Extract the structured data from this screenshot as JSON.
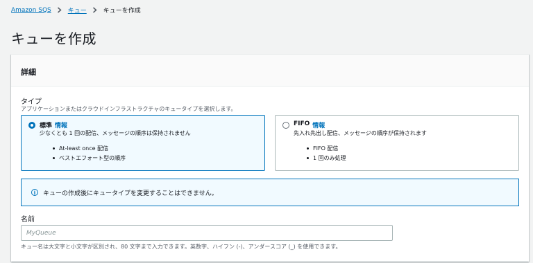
{
  "breadcrumb": {
    "items": [
      "Amazon SQS",
      "キュー"
    ],
    "current": "キューを作成"
  },
  "page": {
    "title": "キューを作成"
  },
  "details": {
    "header": "詳細",
    "type_label": "タイプ",
    "type_description": "アプリケーションまたはクラウドインフラストラクチャのキュータイプを選択します。",
    "options": [
      {
        "title": "標準",
        "info": "情報",
        "description": "少なくとも 1 回の配信、メッセージの順序は保持されません",
        "bullets": [
          "At-least once 配信",
          "ベストエフォート型の順序"
        ],
        "selected": true
      },
      {
        "title": "FIFO",
        "info": "情報",
        "description": "先入れ先出し配信、メッセージの順序が保持されます",
        "bullets": [
          "FIFO 配信",
          "1 回のみ処理"
        ],
        "selected": false
      }
    ],
    "alert": "キューの作成後にキュータイプを変更することはできません。",
    "name_label": "名前",
    "name_placeholder": "MyQueue",
    "name_value": "",
    "name_constraint": "キュー名は大文字と小文字が区別され、80 文字まで入力できます。英数字、ハイフン (-)、アンダースコア (_) を使用できます。"
  },
  "icons": {
    "separator": "chevron-right-icon",
    "alert": "info-icon"
  },
  "colors": {
    "accent": "#0073bb",
    "selected_bg": "#f1faff",
    "page_bg": "#f2f3f3"
  }
}
